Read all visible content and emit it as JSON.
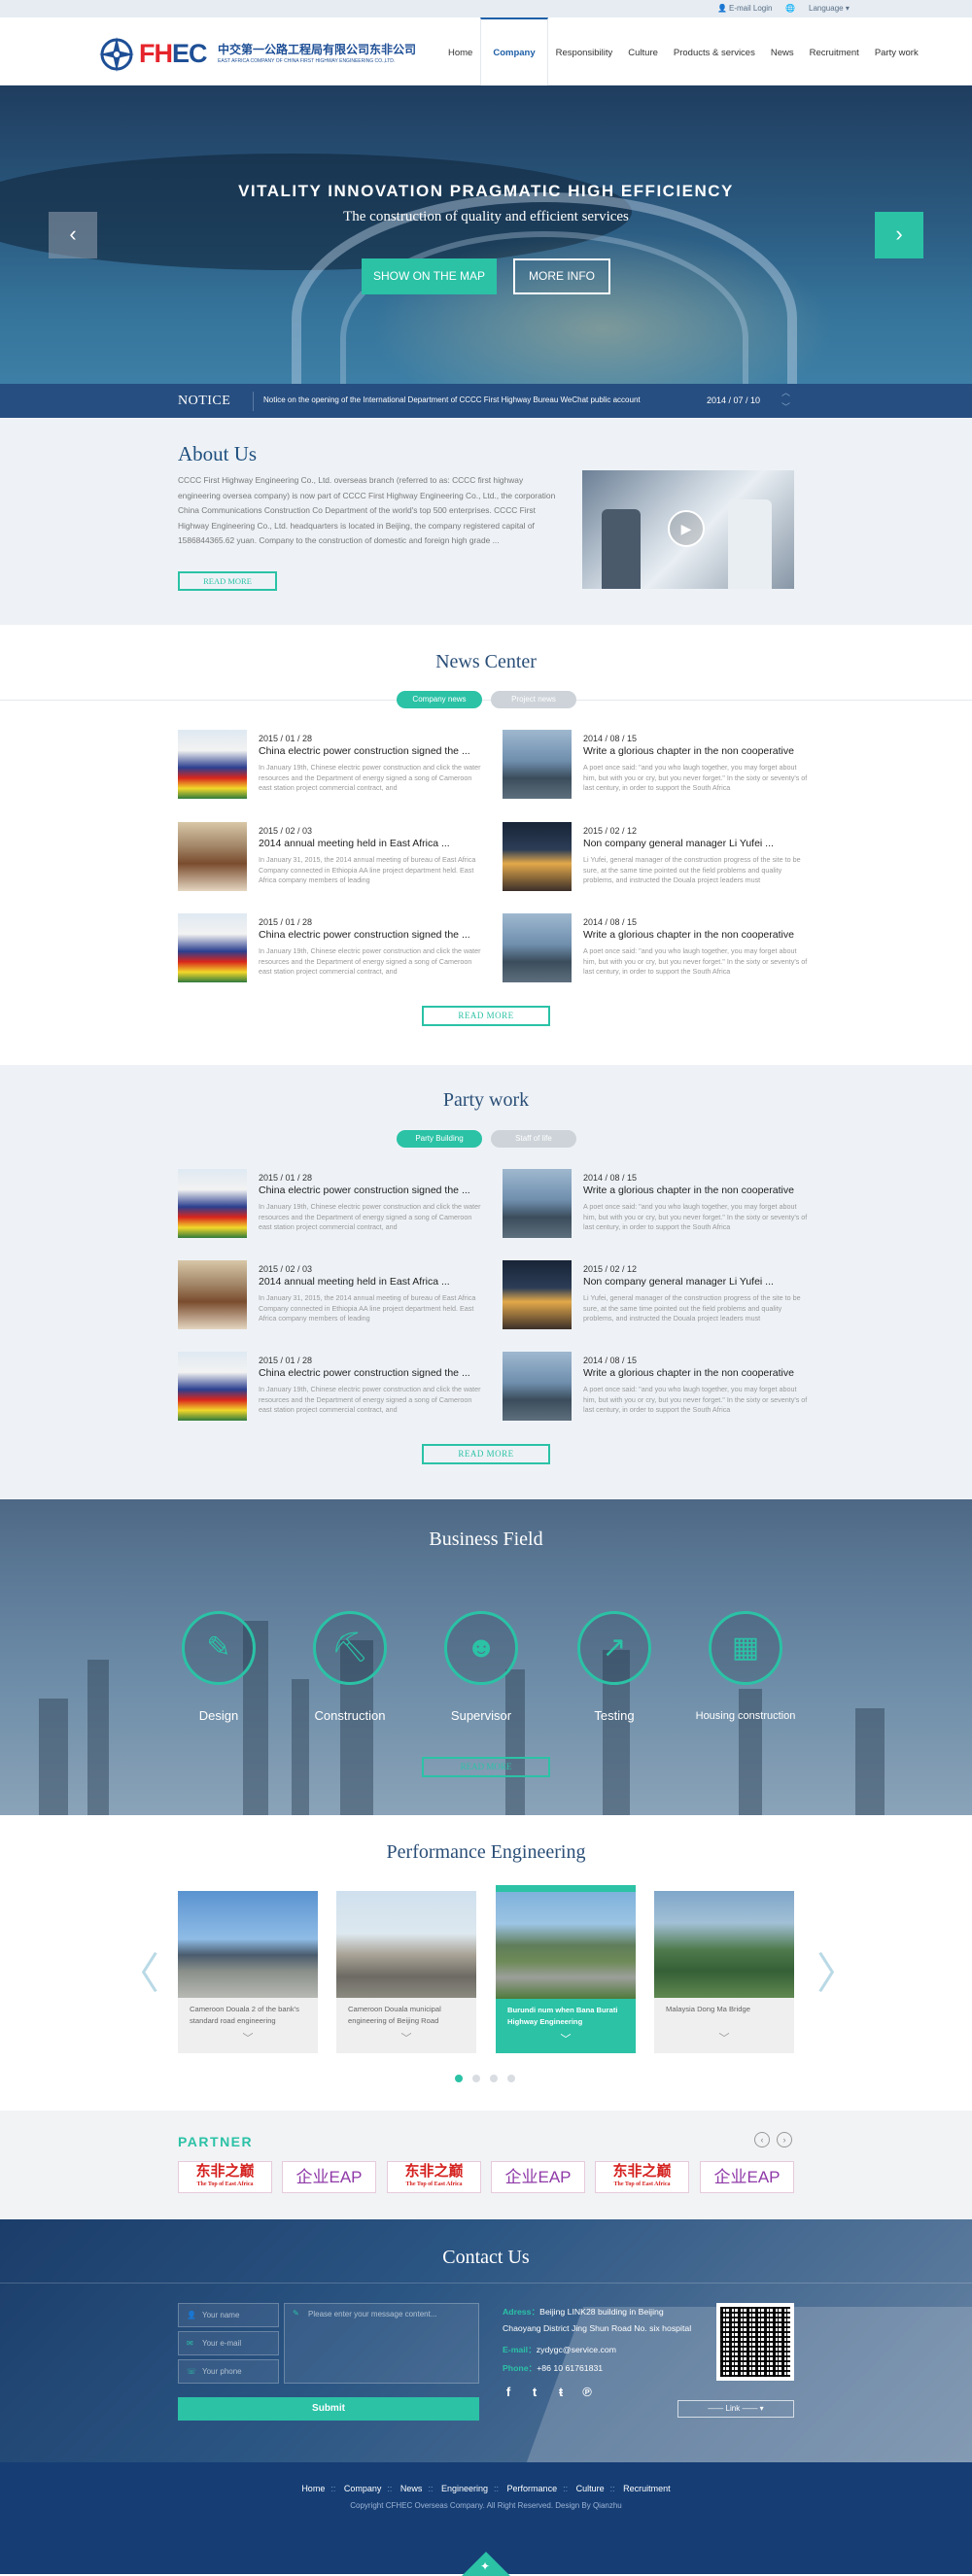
{
  "topbar": {
    "login": "E-mail Login",
    "language": "Language"
  },
  "logo": {
    "brand_f": "FH",
    "brand_b": "EC",
    "cn_name": "中交第一公路工程局有限公司东非公司",
    "en_name": "EAST AFRICA COMPANY OF CHINA FIRST HIGHWAY ENGINEERING CO.,LTD."
  },
  "nav": [
    "Home",
    "Company",
    "Responsibility",
    "Culture",
    "Products & services",
    "News",
    "Recruitment",
    "Party work"
  ],
  "nav_active": "Company",
  "hero": {
    "title": "VITALITY INNOVATION PRAGMATIC HIGH EFFICIENCY",
    "subtitle": "The construction of quality and efficient services",
    "btn_map": "SHOW ON THE MAP",
    "btn_more": "MORE INFO",
    "prev": "‹",
    "next": "›"
  },
  "notice": {
    "label": "NOTICE",
    "text": "Notice on the opening of the International Department of CCCC First Highway Bureau WeChat public account",
    "date": "2014 / 07 / 10"
  },
  "about": {
    "title": "About Us",
    "text": "CCCC First Highway Engineering Co., Ltd. overseas branch (referred to as: CCCC first highway engineering oversea company) is now part of CCCC First Highway Engineering Co., Ltd., the corporation China Communications Construction Co Department of the world's top 500 enterprises. CCCC First Highway Engineering Co., Ltd. headquarters is located in Beijing, the company registered capital of 1586844365.62 yuan. Company to the construction of domestic and foreign high grade ...",
    "btn": "READ MORE"
  },
  "news": {
    "title": "News Center",
    "tabs": [
      "Company news",
      "Project news"
    ],
    "items": [
      {
        "date": "2015 / 01 / 28",
        "head": "China electric power construction signed the ...",
        "text": "In January 19th, Chinese electric power construction and click the water resources and the Department of energy signed a song of Cameroon east station project commercial contract, and"
      },
      {
        "date": "2014 / 08 / 15",
        "head": "Write a glorious chapter in the non cooperative",
        "text": "A poet once said: \"and you who laugh together, you may forget about him, but with you or cry, but you never forget.\" In the sixty or seventy's of last century, in order to support the South Africa"
      },
      {
        "date": "2015 / 02 / 03",
        "head": "2014 annual meeting held in East Africa ...",
        "text": "In January 31, 2015, the 2014 annual meeting of bureau of East Africa Company connected in Ethiopia AA line project department held. East Africa company members of leading"
      },
      {
        "date": "2015 / 02 / 12",
        "head": "Non company general manager Li Yufei ...",
        "text": "Li Yufei, general manager of the construction progress of the site to be sure, at the same time pointed out the field problems and quality problems, and instructed the Douala project leaders must"
      },
      {
        "date": "2015 / 01 / 28",
        "head": "China electric power construction signed the ...",
        "text": "In January 19th, Chinese electric power construction and click the water resources and the Department of energy signed a song of Cameroon east station project commercial contract, and"
      },
      {
        "date": "2014 / 08 / 15",
        "head": "Write a glorious chapter in the non cooperative",
        "text": "A poet once said: \"and you who laugh together, you may forget about him, but with you or cry, but you never forget.\" In the sixty or seventy's of last century, in order to support the South Africa"
      }
    ],
    "btn": "READ MORE"
  },
  "party": {
    "title": "Party work",
    "tabs": [
      "Party Building",
      "Staff of life"
    ],
    "items": [
      {
        "date": "2015 / 01 / 28",
        "head": "China electric power construction signed the ...",
        "text": "In January 19th, Chinese electric power construction and click the water resources and the Department of energy signed a song of Cameroon east station project commercial contract, and"
      },
      {
        "date": "2014 / 08 / 15",
        "head": "Write a glorious chapter in the non cooperative",
        "text": "A poet once said: \"and you who laugh together, you may forget about him, but with you or cry, but you never forget.\" In the sixty or seventy's of last century, in order to support the South Africa"
      },
      {
        "date": "2015 / 02 / 03",
        "head": "2014 annual meeting held in East Africa ...",
        "text": "In January 31, 2015, the 2014 annual meeting of bureau of East Africa Company connected in Ethiopia AA line project department held. East Africa company members of leading"
      },
      {
        "date": "2015 / 02 / 12",
        "head": "Non company general manager Li Yufei ...",
        "text": "Li Yufei, general manager of the construction progress of the site to be sure, at the same time pointed out the field problems and quality problems, and instructed the Douala project leaders must"
      },
      {
        "date": "2015 / 01 / 28",
        "head": "China electric power construction signed the ...",
        "text": "In January 19th, Chinese electric power construction and click the water resources and the Department of energy signed a song of Cameroon east station project commercial contract, and"
      },
      {
        "date": "2014 / 08 / 15",
        "head": "Write a glorious chapter in the non cooperative",
        "text": "A poet once said: \"and you who laugh together, you may forget about him, but with you or cry, but you never forget.\" In the sixty or seventy's of last century, in order to support the South Africa"
      }
    ],
    "btn": "READ MORE"
  },
  "business": {
    "title": "Business Field",
    "items": [
      {
        "label": "Design",
        "icon": "design-icon"
      },
      {
        "label": "Construction",
        "icon": "crane-icon"
      },
      {
        "label": "Supervisor",
        "icon": "worker-icon"
      },
      {
        "label": "Testing",
        "icon": "chart-icon"
      },
      {
        "label": "Housing construction",
        "icon": "building-icon"
      }
    ],
    "btn": "READ MORE"
  },
  "performance": {
    "title": "Performance Engineering",
    "items": [
      {
        "text": "Cameroon Douala 2 of the bank's standard road engineering"
      },
      {
        "text": "Cameroon Douala municipal engineering of Beijing Road"
      },
      {
        "text": "Burundi num when Bana Burati Highway Engineering"
      },
      {
        "text": "Malaysia Dong Ma Bridge"
      }
    ]
  },
  "partner": {
    "title": "PARTNER",
    "logo_a": "东非之巅",
    "logo_a_sub": "The Top of East Africa",
    "logo_b": "企业EAP"
  },
  "contact": {
    "title": "Contact Us",
    "name_ph": "Your name",
    "email_ph": "Your e-mail",
    "phone_ph": "Your phone",
    "msg_ph": "Please enter your message content...",
    "submit": "Submit",
    "address_label": "Adress：",
    "address_1": "Beijing LINK28 building in Beijing",
    "address_2": "Chaoyang District Jing Shun Road No. six hospital",
    "email_label": "E-mail：",
    "email": "zydygc@service.com",
    "phone_label": "Phone：",
    "phone": "+86 10 61761831",
    "link": "Link"
  },
  "footer": {
    "links": [
      "Home",
      "Company",
      "News",
      "Engineering",
      "Performance",
      "Culture",
      "Recruitment"
    ],
    "copyright": "Copyright CFHEC Overseas Company. All Right Reserved.    Design By Qianzhu"
  },
  "colors": {
    "accent": "#2bc2a6",
    "navy": "#163e75",
    "notice": "#274e80"
  }
}
